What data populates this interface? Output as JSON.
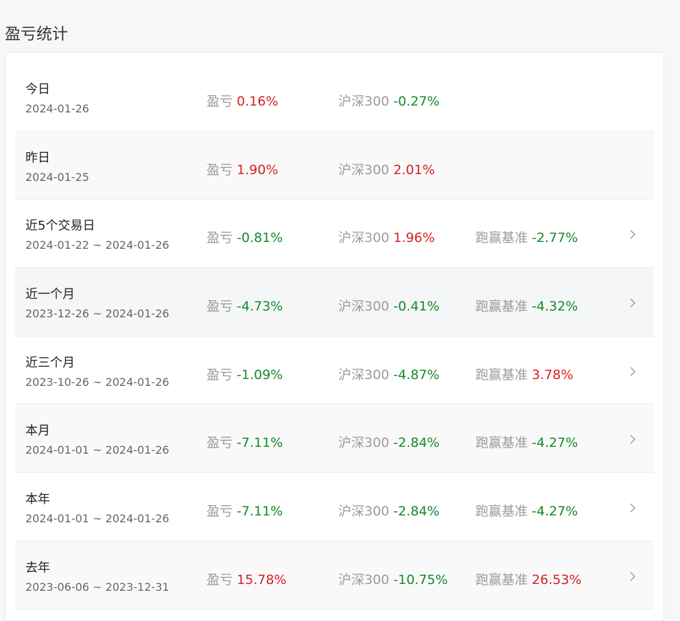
{
  "page": {
    "title": "盈亏统计"
  },
  "labels": {
    "pnl": "盈亏",
    "index": "沪深300",
    "beat": "跑赢基准"
  },
  "colors": {
    "up": "#d81e1e",
    "down": "#118a2a",
    "label": "#9b9b9b"
  },
  "rows": [
    {
      "name": "今日",
      "range": "2024-01-26",
      "pnl": "0.16%",
      "pnl_dir": "up",
      "index": "-0.27%",
      "index_dir": "down",
      "beat": "",
      "beat_dir": "",
      "has_chevron": false,
      "style": ""
    },
    {
      "name": "昨日",
      "range": "2024-01-25",
      "pnl": "1.90%",
      "pnl_dir": "up",
      "index": "2.01%",
      "index_dir": "up",
      "beat": "",
      "beat_dir": "",
      "has_chevron": false,
      "style": "alt"
    },
    {
      "name": "近5个交易日",
      "range": "2024-01-22 ~ 2024-01-26",
      "pnl": "-0.81%",
      "pnl_dir": "down",
      "index": "1.96%",
      "index_dir": "up",
      "beat": "-2.77%",
      "beat_dir": "down",
      "has_chevron": true,
      "style": ""
    },
    {
      "name": "近一个月",
      "range": "2023-12-26 ~ 2024-01-26",
      "pnl": "-4.73%",
      "pnl_dir": "down",
      "index": "-0.41%",
      "index_dir": "down",
      "beat": "-4.32%",
      "beat_dir": "down",
      "has_chevron": true,
      "style": "hl"
    },
    {
      "name": "近三个月",
      "range": "2023-10-26 ~ 2024-01-26",
      "pnl": "-1.09%",
      "pnl_dir": "down",
      "index": "-4.87%",
      "index_dir": "down",
      "beat": "3.78%",
      "beat_dir": "up",
      "has_chevron": true,
      "style": ""
    },
    {
      "name": "本月",
      "range": "2024-01-01 ~ 2024-01-26",
      "pnl": "-7.11%",
      "pnl_dir": "down",
      "index": "-2.84%",
      "index_dir": "down",
      "beat": "-4.27%",
      "beat_dir": "down",
      "has_chevron": true,
      "style": "alt"
    },
    {
      "name": "本年",
      "range": "2024-01-01 ~ 2024-01-26",
      "pnl": "-7.11%",
      "pnl_dir": "down",
      "index": "-2.84%",
      "index_dir": "down",
      "beat": "-4.27%",
      "beat_dir": "down",
      "has_chevron": true,
      "style": ""
    },
    {
      "name": "去年",
      "range": "2023-06-06 ~ 2023-12-31",
      "pnl": "15.78%",
      "pnl_dir": "up",
      "index": "-10.75%",
      "index_dir": "down",
      "beat": "26.53%",
      "beat_dir": "up",
      "has_chevron": true,
      "style": "alt"
    }
  ]
}
